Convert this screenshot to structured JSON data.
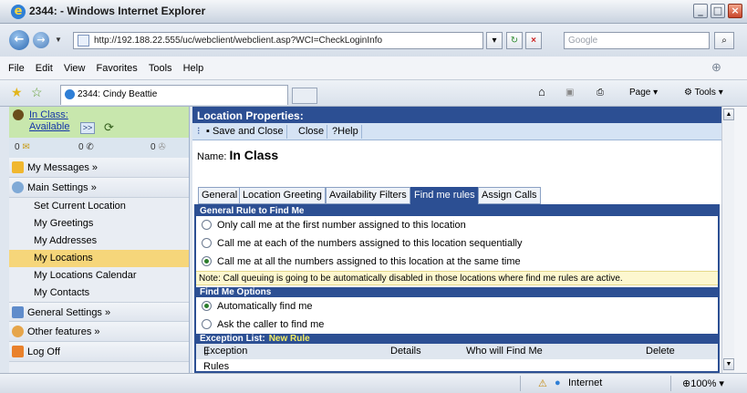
{
  "window": {
    "title": "2344: - Windows Internet Explorer"
  },
  "address": {
    "url": "http://192.188.22.555/uc/webclient/webclient.asp?WCI=CheckLoginInfo",
    "search_placeholder": "Google"
  },
  "menu": [
    "File",
    "Edit",
    "View",
    "Favorites",
    "Tools",
    "Help"
  ],
  "browser_tab": {
    "label": "2344: Cindy Beattie"
  },
  "toolbar_right": {
    "page": "Page",
    "tools": "Tools"
  },
  "left_panel": {
    "status_line1": "In Class:",
    "status_line2": "Available",
    "status_arrow": ">>",
    "counts": [
      "0",
      "0",
      "0"
    ],
    "sections": [
      {
        "label": "My Messages »",
        "icon": "folder-icon"
      },
      {
        "label": "Main Settings »",
        "icon": "settings-icon"
      }
    ],
    "sub_items": [
      "Set Current Location",
      "My Greetings",
      "My Addresses",
      "My Locations",
      "My Locations Calendar",
      "My Contacts"
    ],
    "active_item": "My Locations",
    "bottom_sections": [
      {
        "label": "General Settings »",
        "icon": "general-settings-icon"
      },
      {
        "label": "Other features »",
        "icon": "other-features-icon"
      },
      {
        "label": "Log Off",
        "icon": "logoff-icon"
      }
    ]
  },
  "main": {
    "title": "Location Properties:",
    "toolbar": {
      "save_close": "Save and Close",
      "close": "Close",
      "help": "Help"
    },
    "name_label": "Name:",
    "name_value": "In Class",
    "tabs": [
      "General",
      "Location Greeting",
      "Availability Filters",
      "Find me rules",
      "Assign Calls"
    ],
    "active_tab": "Find me rules",
    "general_rule_header": "General Rule to Find Me",
    "general_rule_options": [
      "Only call me at the first number assigned to this location",
      "Call me at each of the numbers assigned to this location sequentially",
      "Call me at all the numbers assigned to this location at the same time"
    ],
    "general_rule_selected": 2,
    "note": "Note: Call queuing is going to be automatically disabled in those locations where find me rules are active.",
    "find_me_header": "Find Me Options",
    "find_me_options": [
      "Automatically find me",
      "Ask the caller to find me"
    ],
    "find_me_selected": 0,
    "exception_header": "Exception List:",
    "exception_link": "New Rule",
    "exception_columns": [
      "Exception Rules",
      "Details",
      "Who will Find Me",
      "Delete"
    ]
  },
  "statusbar": {
    "zone": "Internet",
    "zoom": "100%"
  },
  "colors": {
    "accent": "#2c4f93",
    "status_green": "#c8e7ad",
    "active_item": "#f6d67a",
    "note_bg": "#fdf7cf"
  }
}
